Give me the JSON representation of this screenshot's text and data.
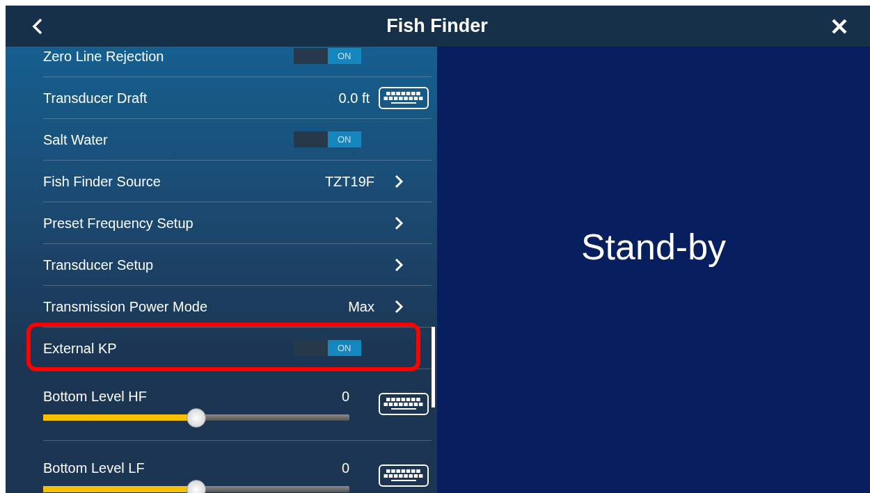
{
  "header": {
    "title": "Fish Finder"
  },
  "settings": [
    {
      "kind": "toggle",
      "label": "Zero Line Rejection",
      "on": true,
      "state_text": "ON",
      "highlighted": false
    },
    {
      "kind": "keyboard",
      "label": "Transducer Draft",
      "value": "0.0 ft",
      "highlighted": false
    },
    {
      "kind": "toggle",
      "label": "Salt Water",
      "on": true,
      "state_text": "ON",
      "highlighted": false
    },
    {
      "kind": "link",
      "label": "Fish Finder Source",
      "value": "TZT19F",
      "highlighted": false
    },
    {
      "kind": "link",
      "label": "Preset Frequency Setup",
      "highlighted": false
    },
    {
      "kind": "link",
      "label": "Transducer Setup",
      "highlighted": false
    },
    {
      "kind": "link",
      "label": "Transmission Power Mode",
      "value": "Max",
      "highlighted": false
    },
    {
      "kind": "toggle",
      "label": "External KP",
      "on": true,
      "state_text": "ON",
      "highlighted": true
    },
    {
      "kind": "slider",
      "label": "Bottom Level HF",
      "value": "0",
      "level": 0.5,
      "highlighted": false
    },
    {
      "kind": "slider",
      "label": "Bottom Level LF",
      "value": "0",
      "level": 0.5,
      "highlighted": false
    }
  ],
  "status": {
    "text": "Stand-by"
  }
}
